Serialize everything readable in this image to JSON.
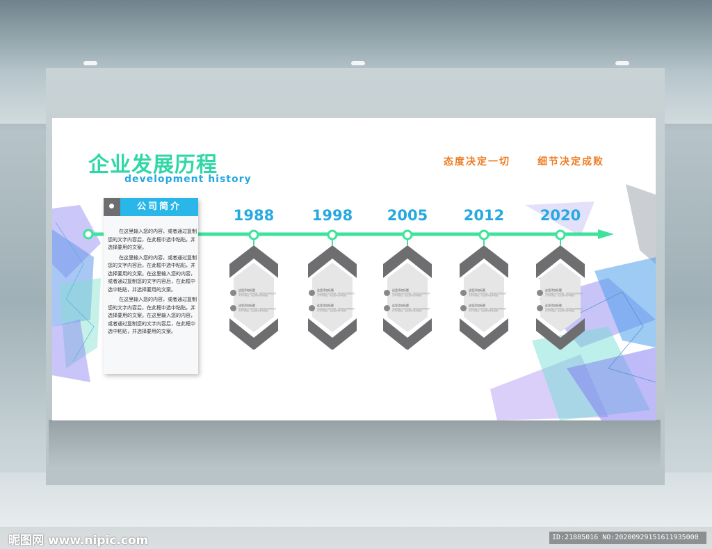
{
  "title_cn": "企业发展历程",
  "title_en": "development history",
  "slogans": [
    "态度决定一切",
    "细节决定成败"
  ],
  "intro": {
    "heading": "公司简介",
    "paragraphs": [
      "在这里输入您的内容，或者通过复制您的文字内容后，在此框中选中粘贴，并选择要用的文案。",
      "在这里输入您的内容，或者通过复制您的文字内容后，在此框中选中粘贴，并选择要用的文案。在这里输入您的内容，或者通过复制您的文字内容后，在此框中选中粘贴，并选择要用的文案。",
      "在这里输入您的内容，或者通过复制您的文字内容后，在此框中选中粘贴，并选择要用的文案。在这里输入您的内容，或者通过复制您的文字内容后，在此框中选中粘贴，并选择要用的文案。"
    ]
  },
  "timeline": {
    "years": [
      "1988",
      "1998",
      "2005",
      "2012",
      "2020"
    ],
    "item_title": "这里添加标题",
    "item_text": "在这里输入您的内容，或者通过复制您的文字内容后，在此框中选中粘贴"
  },
  "colors": {
    "title_green": "#2fd7a6",
    "accent_blue": "#27a9e0",
    "timeline_green": "#3ee39b",
    "slogan_orange": "#ee7b22",
    "chevron_gray": "#6e6e70"
  },
  "watermark": {
    "site": "昵图网 www.nipic.com",
    "id": "ID:21885016 NO:20200929151611935000"
  }
}
